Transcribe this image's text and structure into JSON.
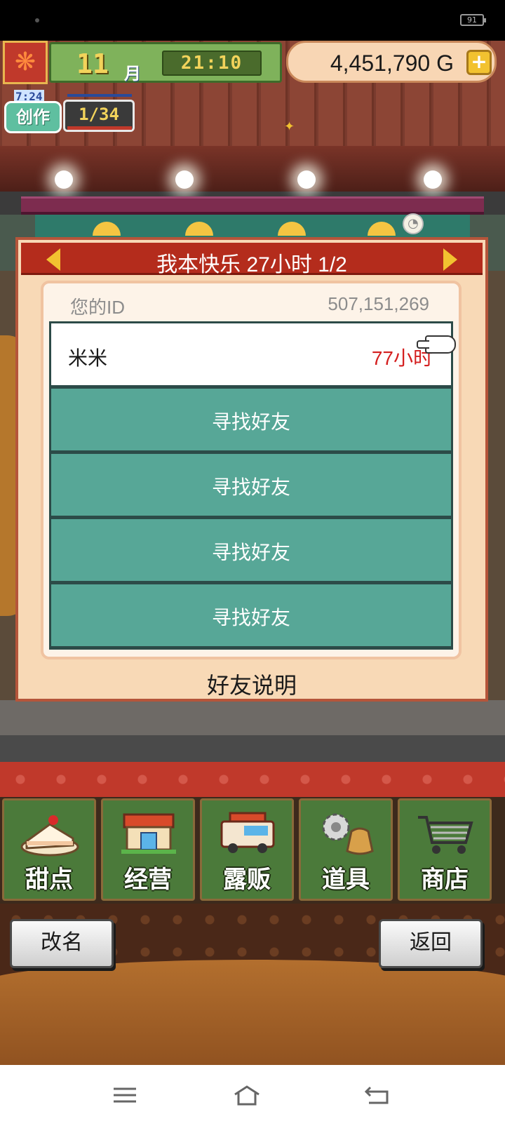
{
  "status_bar": {
    "battery": "91"
  },
  "hud": {
    "month_number": "11",
    "month_label": "月",
    "time": "21:10",
    "gold": "4,451,790 G",
    "add_gold_symbol": "+",
    "craft": {
      "timer": "7:24",
      "label": "创作",
      "count": "1/34"
    }
  },
  "dialog": {
    "title": "我本快乐  27小时 1/2",
    "your_id_label": "您的ID",
    "your_id_value": "507,151,269",
    "friends": [
      {
        "name": "米米",
        "hours": "77小时"
      }
    ],
    "empty_slots": [
      "寻找好友",
      "寻找好友",
      "寻找好友",
      "寻找好友"
    ],
    "help_link": "好友说明"
  },
  "categories": [
    {
      "label": "甜点",
      "icon": "cake-icon"
    },
    {
      "label": "经营",
      "icon": "shop-icon"
    },
    {
      "label": "露贩",
      "icon": "food-truck-icon"
    },
    {
      "label": "道具",
      "icon": "gear-bag-icon"
    },
    {
      "label": "商店",
      "icon": "shopping-cart-icon"
    }
  ],
  "actions": {
    "rename": "改名",
    "back": "返回"
  },
  "colors": {
    "teal_slot": "#57a797",
    "header_red": "#b42c1c",
    "hours_red": "#d41f1f",
    "menu_green": "#4b7a3a"
  }
}
